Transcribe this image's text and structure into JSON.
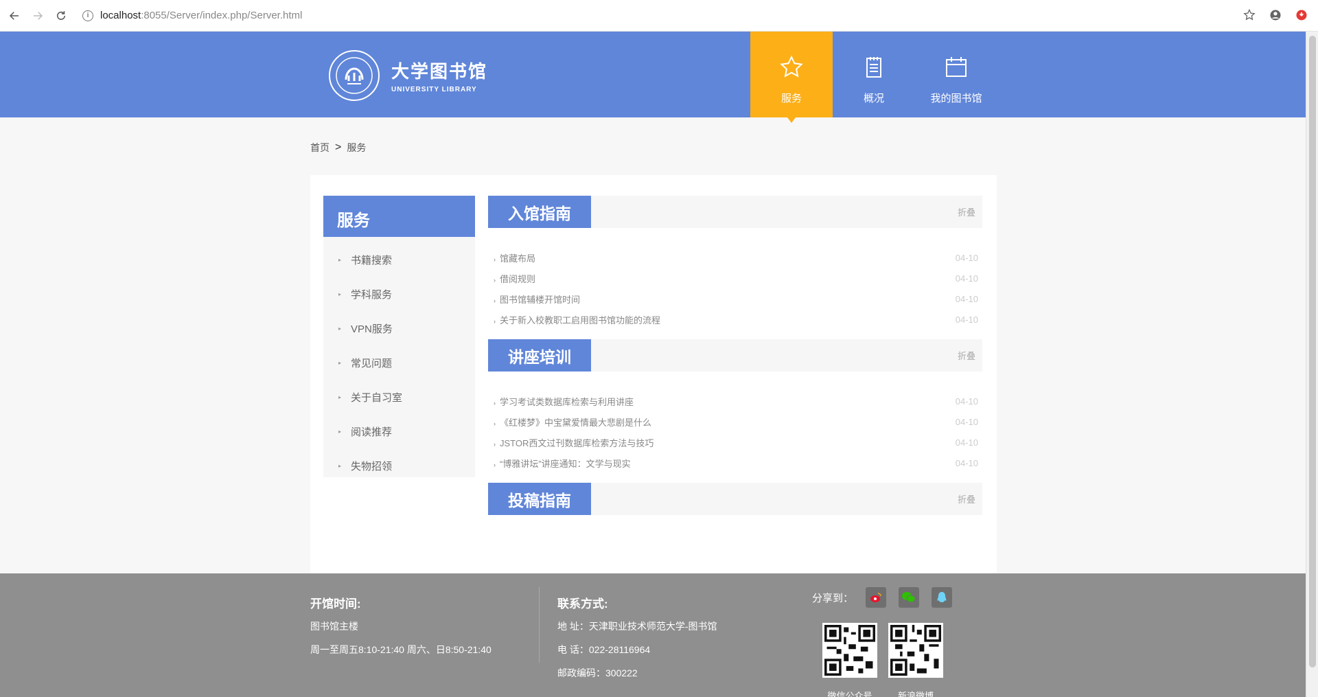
{
  "browser": {
    "url_host": "localhost",
    "url_path": ":8055/Server/index.php/Server.html"
  },
  "header": {
    "logo_cn": "大学图书馆",
    "logo_en": "UNIVERSITY LIBRARY",
    "nav": [
      {
        "label": "服务",
        "icon": "star-icon",
        "active": true
      },
      {
        "label": "概况",
        "icon": "notepad-icon",
        "active": false
      },
      {
        "label": "我的图书馆",
        "icon": "calendar-icon",
        "active": false
      }
    ]
  },
  "breadcrumb": {
    "home": "首页",
    "sep": ">",
    "current": "服务"
  },
  "sidebar": {
    "title": "服务",
    "items": [
      "书籍搜索",
      "学科服务",
      "VPN服务",
      "常见问题",
      "关于自习室",
      "阅读推荐",
      "失物招领"
    ]
  },
  "sections": [
    {
      "title": "入馆指南",
      "fold": "折叠",
      "items": [
        {
          "text": "馆藏布局",
          "date": "04-10"
        },
        {
          "text": "借阅规则",
          "date": "04-10"
        },
        {
          "text": "图书馆辅楼开馆时间",
          "date": "04-10"
        },
        {
          "text": "关于新入校教职工启用图书馆功能的流程",
          "date": "04-10"
        }
      ]
    },
    {
      "title": "讲座培训",
      "fold": "折叠",
      "items": [
        {
          "text": "学习考试类数据库检索与利用讲座",
          "date": "04-10"
        },
        {
          "text": "《红楼梦》中宝黛爱情最大悲剧是什么",
          "date": "04-10"
        },
        {
          "text": "JSTOR西文过刊数据库检索方法与技巧",
          "date": "04-10"
        },
        {
          "text": "“博雅讲坛”讲座通知：文学与现实",
          "date": "04-10"
        }
      ]
    },
    {
      "title": "投稿指南",
      "fold": "折叠",
      "items": []
    }
  ],
  "footer": {
    "hours_title": "开馆时间:",
    "hours_place": "图书馆主楼",
    "hours_time": "周一至周五8:10-21:40 周六、日8:50-21:40",
    "contact_title": "联系方式:",
    "address": "地 址：天津职业技术师范大学-图书馆",
    "phone": "电 话：022-28116964",
    "postcode": "邮政编码：300222",
    "share_label": "分享到：",
    "qr1_label": "微信公众号",
    "qr2_label": "新浪微博"
  },
  "colors": {
    "header_blue": "#6086d9",
    "active_orange": "#fcaf17",
    "footer_gray": "#8f8f8f"
  }
}
